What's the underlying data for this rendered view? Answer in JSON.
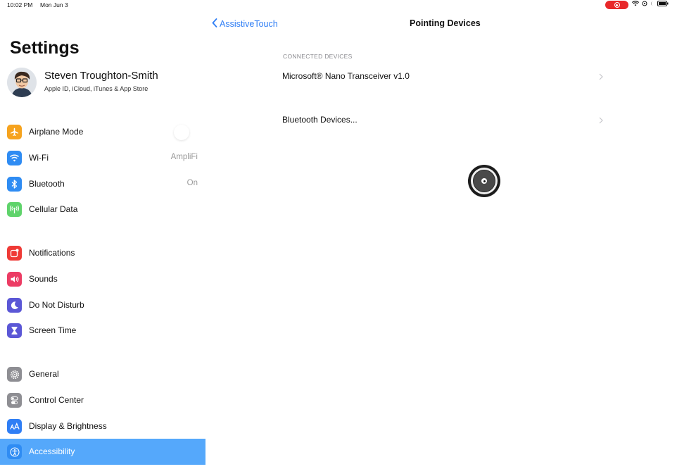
{
  "status_bar": {
    "time": "10:02 PM",
    "date": "Mon Jun 3",
    "recording_color": "#e8282a",
    "icons": [
      "wifi-icon",
      "location-icon",
      "moon-icon",
      "battery-icon"
    ]
  },
  "sidebar": {
    "title": "Settings",
    "profile": {
      "name": "Steven Troughton-Smith",
      "subtitle": "Apple ID, iCloud, iTunes & App Store"
    },
    "groups": [
      {
        "items": [
          {
            "label": "Airplane Mode",
            "value": "",
            "icon": "airplane-icon",
            "color": "#f6a31e"
          },
          {
            "label": "Wi-Fi",
            "value": "AmpliFi",
            "icon": "wifi-icon",
            "color": "#2f8cf3"
          },
          {
            "label": "Bluetooth",
            "value": "On",
            "icon": "bluetooth-icon",
            "color": "#2f8cf3"
          },
          {
            "label": "Cellular Data",
            "value": "",
            "icon": "antenna-icon",
            "color": "#5fd36b"
          }
        ]
      },
      {
        "items": [
          {
            "label": "Notifications",
            "value": "",
            "icon": "notifications-icon",
            "color": "#ef3a36"
          },
          {
            "label": "Sounds",
            "value": "",
            "icon": "speaker-icon",
            "color": "#ec3c64"
          },
          {
            "label": "Do Not Disturb",
            "value": "",
            "icon": "moon-icon",
            "color": "#5b57d6"
          },
          {
            "label": "Screen Time",
            "value": "",
            "icon": "hourglass-icon",
            "color": "#5b57d6"
          }
        ]
      },
      {
        "items": [
          {
            "label": "General",
            "value": "",
            "icon": "gear-icon",
            "color": "#8e8e93"
          },
          {
            "label": "Control Center",
            "value": "",
            "icon": "switches-icon",
            "color": "#8e8e93"
          },
          {
            "label": "Display & Brightness",
            "value": "",
            "icon": "text-size-icon",
            "color": "#2f7ef5"
          },
          {
            "label": "Accessibility",
            "value": "",
            "icon": "accessibility-icon",
            "color": "#2f8cf3",
            "selected": true
          }
        ]
      }
    ]
  },
  "detail": {
    "back_label": "AssistiveTouch",
    "title": "Pointing Devices",
    "section_header": "CONNECTED DEVICES",
    "cells": [
      "Microsoft® Nano Transceiver v1.0",
      "Bluetooth Devices..."
    ],
    "accent_color": "#2f7ef5"
  }
}
